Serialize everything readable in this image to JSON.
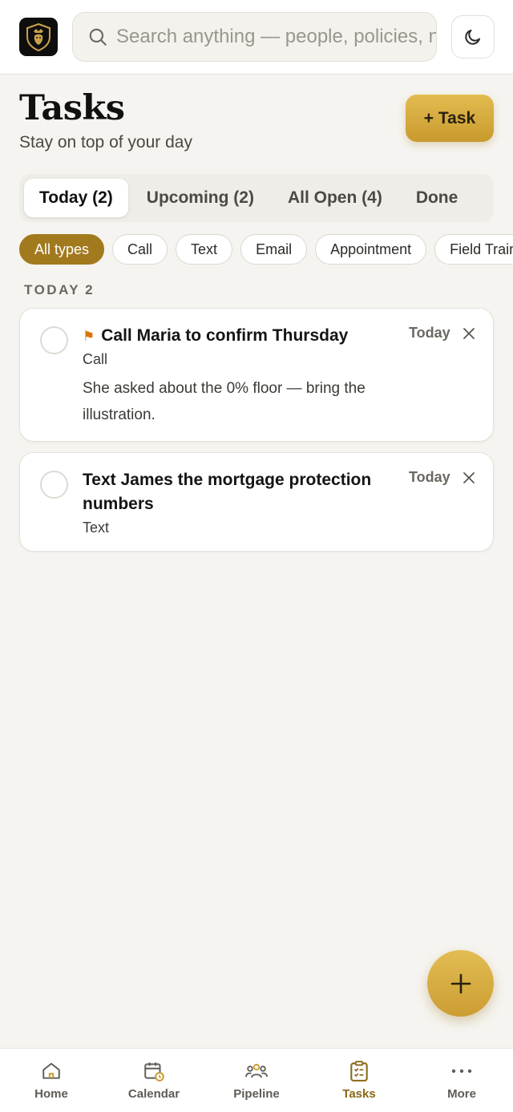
{
  "search": {
    "placeholder": "Search anything — people, policies, notes"
  },
  "header": {
    "title": "Tasks",
    "subtitle": "Stay on top of your day",
    "add_button": "+ Task"
  },
  "tabs": [
    {
      "label": "Today (2)",
      "active": true
    },
    {
      "label": "Upcoming (2)",
      "active": false
    },
    {
      "label": "All Open (4)",
      "active": false
    },
    {
      "label": "Done",
      "active": false
    }
  ],
  "filters": [
    {
      "label": "All types",
      "active": true
    },
    {
      "label": "Call",
      "active": false
    },
    {
      "label": "Text",
      "active": false
    },
    {
      "label": "Email",
      "active": false
    },
    {
      "label": "Appointment",
      "active": false
    },
    {
      "label": "Field Training",
      "active": false
    }
  ],
  "section": {
    "title": "TODAY",
    "count": "2"
  },
  "tasks": [
    {
      "title": "Call Maria to confirm Thursday",
      "flagged": true,
      "type": "Call",
      "note": "She asked about the 0% floor — bring the illustration.",
      "due": "Today"
    },
    {
      "title": "Text James the mortgage protection numbers",
      "flagged": false,
      "type": "Text",
      "note": "",
      "due": "Today"
    }
  ],
  "nav": [
    {
      "label": "Home",
      "icon": "home-icon",
      "active": false
    },
    {
      "label": "Calendar",
      "icon": "calendar-icon",
      "active": false
    },
    {
      "label": "Pipeline",
      "icon": "people-icon",
      "active": false
    },
    {
      "label": "Tasks",
      "icon": "clipboard-check-icon",
      "active": true
    },
    {
      "label": "More",
      "icon": "more-dots-icon",
      "active": false
    }
  ],
  "colors": {
    "accent": "#a27a1e",
    "gold": "#d6ad40",
    "flag": "#d97706"
  }
}
